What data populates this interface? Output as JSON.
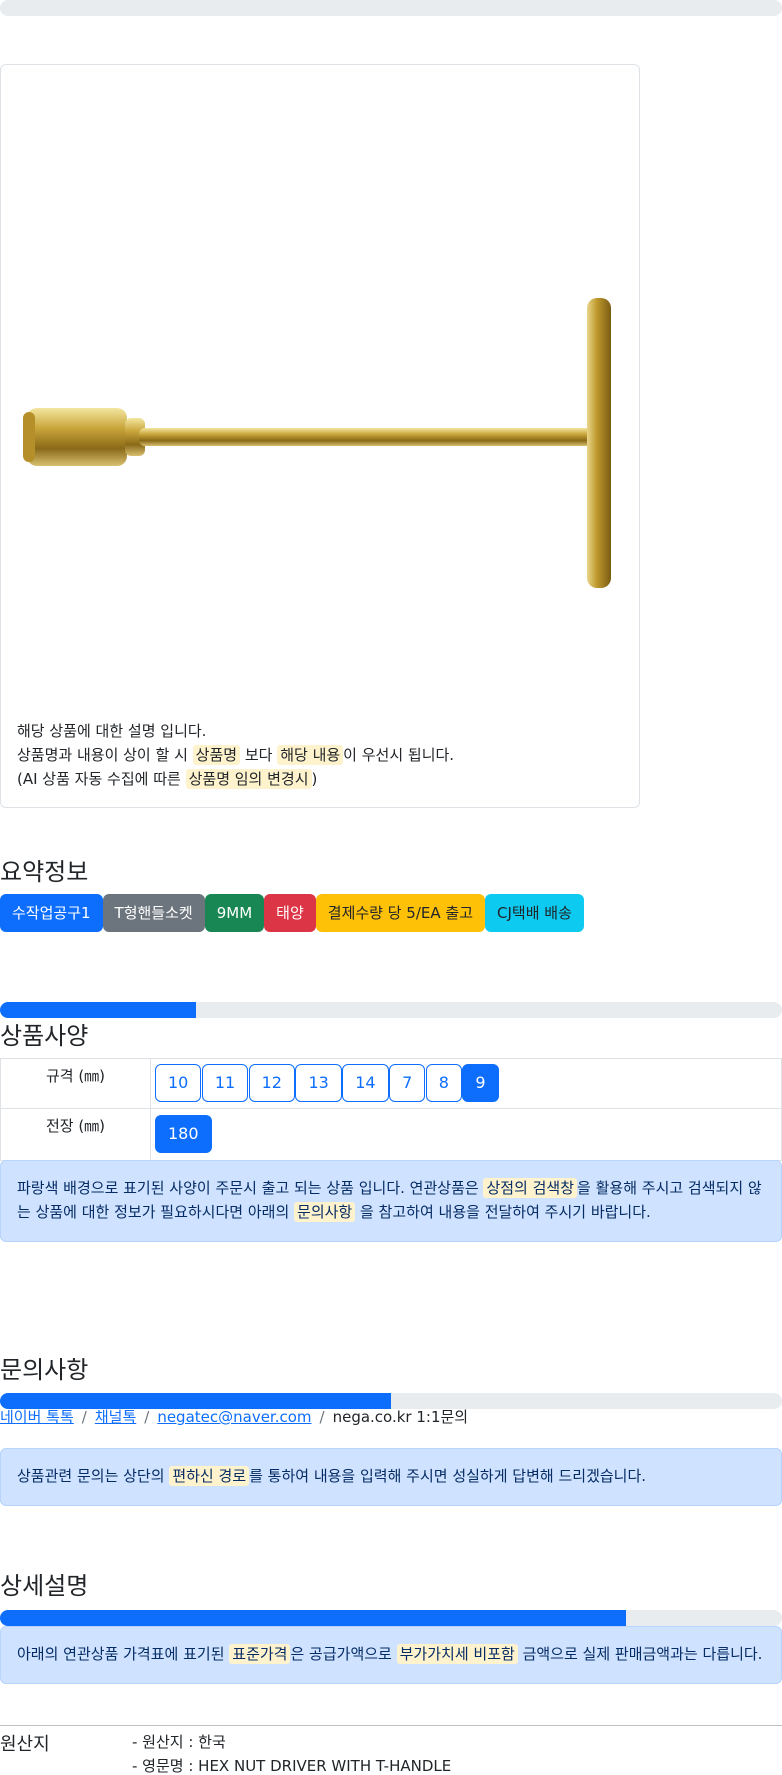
{
  "progress_bars": {
    "top": 0,
    "spec": 0.25,
    "inquiry": 0.5,
    "detail": 0.8
  },
  "product": {
    "image_alt": "T-handle hex nut driver",
    "description_line1": "해당 상품에 대한 설명 입니다.",
    "description_line2_a": "상품명과 내용이 상이 할 시 ",
    "description_line2_hl1": "상품명",
    "description_line2_b": " 보다 ",
    "description_line2_hl2": "해당 내용",
    "description_line2_c": "이 우선시 됩니다.",
    "description_line3_a": "(AI 상품 자동 수집에 따른 ",
    "description_line3_hl": "상품명 임의 변경시",
    "description_line3_b": ")"
  },
  "summary": {
    "title": "요약정보",
    "badges": [
      "수작업공구1",
      "T형핸들소켓",
      "9MM",
      "태양",
      "결제수량 당 5/EA 출고",
      "CJ택배 배송"
    ]
  },
  "spec": {
    "title": "상품사양",
    "rows": [
      {
        "label": "규격 (㎜)",
        "options": [
          "10",
          "11",
          "12",
          "13",
          "14",
          "7",
          "8",
          "9"
        ],
        "selected": "9"
      },
      {
        "label": "전장 (㎜)",
        "options": [
          "180"
        ],
        "selected": "180"
      }
    ],
    "notice_a": "파랑색 배경으로 표기된 사양이 주문시 출고 되는 상품 입니다. 연관상품은 ",
    "notice_hl1": "상점의 검색창",
    "notice_b": "을 활용해 주시고 검색되지 않는 상품에 대한 정보가 필요하시다면 아래의 ",
    "notice_hl2": "문의사항",
    "notice_c": " 을 참고하여 내용을 전달하여 주시기 바랍니다."
  },
  "inquiry": {
    "title": "문의사항",
    "links": [
      "네이버 톡톡",
      "채널톡",
      "negatec@naver.com"
    ],
    "plain": "nega.co.kr 1:1문의",
    "notice_a": "상품관련 문의는 상단의 ",
    "notice_hl": "편하신 경로",
    "notice_b": "를 통하여 내용을 입력해 주시면 성실하게 답변해 드리겠습니다."
  },
  "detail": {
    "title": "상세설명",
    "notice_a": "아래의 연관상품 가격표에 표기된 ",
    "notice_hl1": "표준가격",
    "notice_b": "은 공급가액으로 ",
    "notice_hl2": "부가가치세 비포함",
    "notice_c": " 금액으로 실제 판매금액과는 다릅니다."
  },
  "origin": {
    "label": "원산지",
    "items": [
      "- 원산지 : 한국",
      "- 영문명 : HEX NUT DRIVER WITH T-HANDLE"
    ]
  },
  "colors": {
    "primary": "#0d6efd",
    "alert_bg": "#cfe2ff",
    "highlight": "#fff3cd"
  }
}
